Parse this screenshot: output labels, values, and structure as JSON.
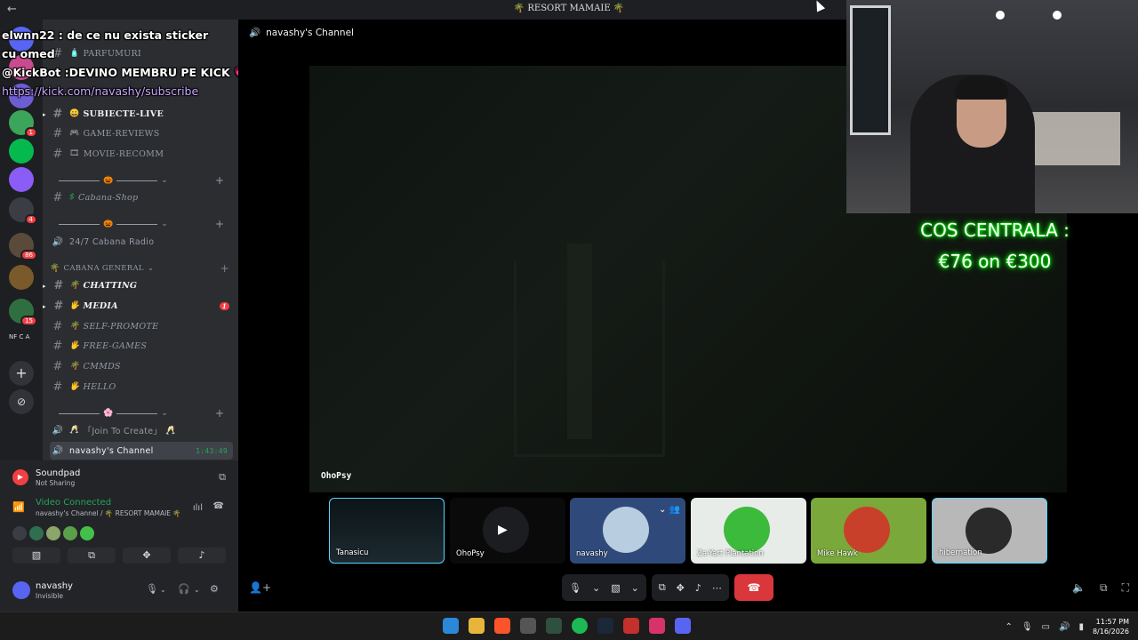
{
  "window": {
    "title": "🌴 RESORT MAMAIE 🌴",
    "back": "←"
  },
  "overlay_chat": {
    "line1": "elwnn22 : de ce nu exista sticker",
    "line2": "cu omed",
    "line3": "@KickBot :DEVINO MEMBRU PE KICK 💗",
    "line4": "https://kick.com/navashy/subscribe"
  },
  "servers": {
    "badges": [
      "1",
      "4",
      "86",
      "15"
    ],
    "text_server": "NF C A"
  },
  "channels": [
    {
      "label": "PARFUMURI",
      "emoji": "🧴"
    },
    {
      "label": "SUBIECTE-LIVE",
      "emoji": "😀"
    },
    {
      "label": "GAME-REVIEWS",
      "emoji": "🎮"
    },
    {
      "label": "MOVIE-RECOMM",
      "emoji": "🎞"
    },
    {
      "label": "Cabana-Shop",
      "emoji": "$"
    },
    {
      "label": "24/7 Cabana Radio"
    },
    {
      "label": "CABANA GENERAL"
    },
    {
      "label": "CHATTING",
      "emoji": "🌴"
    },
    {
      "label": "MEDIA",
      "emoji": "🖐",
      "badge": "1"
    },
    {
      "label": "SELF-PROMOTE",
      "emoji": "🌴"
    },
    {
      "label": "FREE-GAMES",
      "emoji": "🖐"
    },
    {
      "label": "CMMDS",
      "emoji": "🌴"
    },
    {
      "label": "HELLO",
      "emoji": "🖐"
    },
    {
      "label": "「Join To Create」"
    },
    {
      "label": "navashy's Channel",
      "timer": "1:43:49"
    }
  ],
  "divider_icons": [
    "🎃",
    "🎃",
    "🌸"
  ],
  "soundpad": {
    "name": "Soundpad",
    "status": "Not Sharing"
  },
  "voice": {
    "status": "Video Connected",
    "location": "navashy's Channel / 🌴 RESORT MAMAIE 🌴"
  },
  "user": {
    "name": "navashy",
    "status": "Invisible"
  },
  "stage": {
    "header": "navashy's Channel",
    "main_label": "OhoPsy",
    "goal_line1": "COS CENTRALA :",
    "goal_line2": "€76 on €300"
  },
  "tiles": [
    "Tanasicu",
    "OhoPsy",
    "navashy",
    "Za-Yart Plantation",
    "Mike Hawk",
    "hibernation"
  ],
  "clock": {
    "time": "11:57 PM",
    "date": "8/16/2026"
  },
  "colors": {
    "accent": "#23a55a",
    "danger": "#da373c",
    "highlight": "#56d7ff"
  }
}
